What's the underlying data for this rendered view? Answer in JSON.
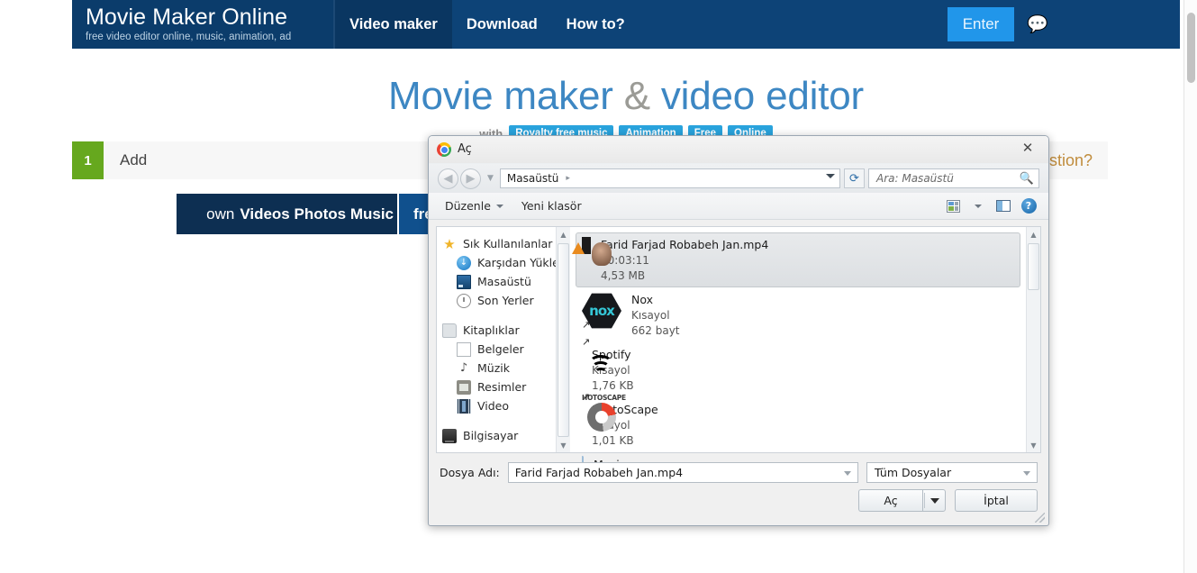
{
  "site": {
    "brand": {
      "title": "Movie Maker Online",
      "subtitle": "free video editor online, music, animation, ad"
    },
    "nav": [
      {
        "label": "Video maker",
        "active": true
      },
      {
        "label": "Download",
        "active": false
      },
      {
        "label": "How to?",
        "active": false
      }
    ],
    "enter_label": "Enter",
    "chat_icon": "speech-bubble-icon",
    "hero": {
      "title_part1": "Movie maker ",
      "title_amp": "&",
      "title_part2": " video editor",
      "with_label": "with",
      "tags": [
        "Royalty free music",
        "Animation",
        "Free",
        "Online"
      ]
    },
    "step": {
      "number": "1",
      "label": "Add"
    },
    "bands": {
      "own_light": "own",
      "own_bold": "Videos Photos Music",
      "free_partial": "fre"
    },
    "question_partial": "stion?",
    "colors": {
      "nav_blue": "#0d4377",
      "brand_blue": "#0b3c6b",
      "enter_blue": "#2196ea",
      "hero_blue": "#3d87c3",
      "tag_blue": "#29a3dd",
      "step_green": "#66a81e",
      "band_dark": "#0d2f52",
      "band_mid": "#10508d",
      "question_orange": "#c08c3c"
    }
  },
  "dialog": {
    "app_icon": "chrome-icon",
    "title": "Aç",
    "close_label": "✕",
    "nav": {
      "back_icon": "arrow-left-icon",
      "forward_icon": "arrow-right-icon",
      "history_icon": "chevron-down-icon",
      "address_value": "Masaüstü",
      "address_separator": "▸",
      "refresh_icon": "refresh-icon",
      "search_placeholder": "Ara: Masaüstü",
      "search_icon": "search-icon"
    },
    "toolbar": {
      "organize_label": "Düzenle",
      "new_folder_label": "Yeni klasör",
      "views_icon": "view-options-icon",
      "preview_pane_icon": "preview-pane-icon",
      "help_icon": "help-icon"
    },
    "sidebar": [
      {
        "label": "Sık Kullanılanlar",
        "icon": "star-icon",
        "indent": false,
        "gap": false
      },
      {
        "label": "Karşıdan Yüklem",
        "icon": "download-icon",
        "indent": true,
        "gap": false
      },
      {
        "label": "Masaüstü",
        "icon": "desktop-icon",
        "indent": true,
        "gap": false
      },
      {
        "label": "Son Yerler",
        "icon": "recent-clock-icon",
        "indent": true,
        "gap": false
      },
      {
        "label": "Kitaplıklar",
        "icon": "folder-icon",
        "indent": false,
        "gap": true
      },
      {
        "label": "Belgeler",
        "icon": "document-icon",
        "indent": true,
        "gap": false
      },
      {
        "label": "Müzik",
        "icon": "music-note-icon",
        "indent": true,
        "gap": false
      },
      {
        "label": "Resimler",
        "icon": "pictures-icon",
        "indent": true,
        "gap": false
      },
      {
        "label": "Video",
        "icon": "video-filmstrip-icon",
        "indent": true,
        "gap": false
      },
      {
        "label": "Bilgisayar",
        "icon": "computer-icon",
        "indent": false,
        "gap": true
      }
    ],
    "files": [
      {
        "name": "Farid Farjad Robabeh Jan.mp4",
        "line2": "00:03:11",
        "line3": "4,53 MB",
        "icon": "video-thumbnail",
        "selected": true,
        "shortcut": false
      },
      {
        "name": "Nox",
        "line2": "Kısayol",
        "line3": "662 bayt",
        "icon": "nox-icon",
        "selected": false,
        "shortcut": true
      },
      {
        "name": "Spotify",
        "line2": "Kısayol",
        "line3": "1,76 KB",
        "icon": "spotify-icon",
        "selected": false,
        "shortcut": true
      },
      {
        "name": "PhotoScape",
        "line2": "Kısayol",
        "line3": "1,01 KB",
        "icon": "photoscape-icon",
        "selected": false,
        "shortcut": true
      },
      {
        "name": "Musics",
        "line2": "",
        "line3": "",
        "icon": "folder-icon",
        "selected": false,
        "shortcut": false
      }
    ],
    "footer": {
      "filename_label": "Dosya Adı:",
      "filename_value": "Farid Farjad Robabeh Jan.mp4",
      "filter_value": "Tüm Dosyalar",
      "open_label": "Aç",
      "cancel_label": "İptal"
    }
  }
}
